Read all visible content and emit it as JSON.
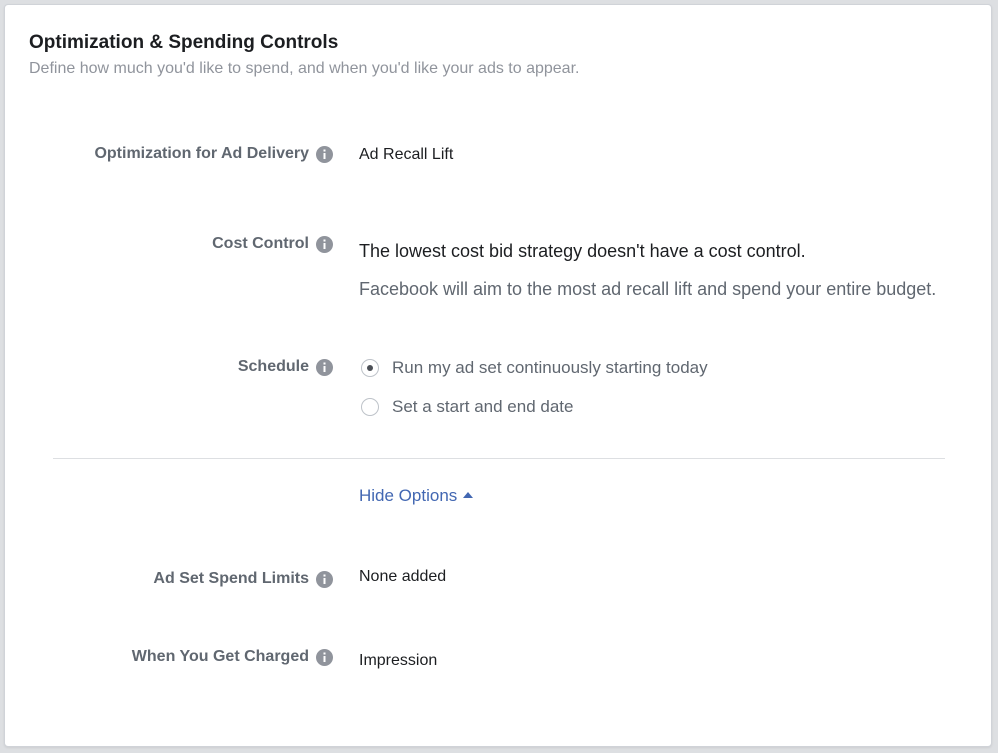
{
  "section": {
    "title": "Optimization & Spending Controls",
    "subtitle": "Define how much you'd like to spend, and when you'd like your ads to appear."
  },
  "optimization": {
    "label": "Optimization for Ad Delivery",
    "value": "Ad Recall Lift"
  },
  "cost_control": {
    "label": "Cost Control",
    "headline": "The lowest cost bid strategy doesn't have a cost control.",
    "description": "Facebook will aim to the most ad recall lift and spend your entire budget."
  },
  "schedule": {
    "label": "Schedule",
    "options": [
      {
        "label": "Run my ad set continuously starting today",
        "selected": true
      },
      {
        "label": "Set a start and end date",
        "selected": false
      }
    ]
  },
  "toggle": {
    "label": "Hide Options"
  },
  "spend_limits": {
    "label": "Ad Set Spend Limits",
    "value": "None added"
  },
  "charged": {
    "label": "When You Get Charged",
    "value": "Impression"
  },
  "colors": {
    "link": "#4267b2",
    "label": "#606770",
    "text": "#1c1e21",
    "muted": "#90949c"
  }
}
